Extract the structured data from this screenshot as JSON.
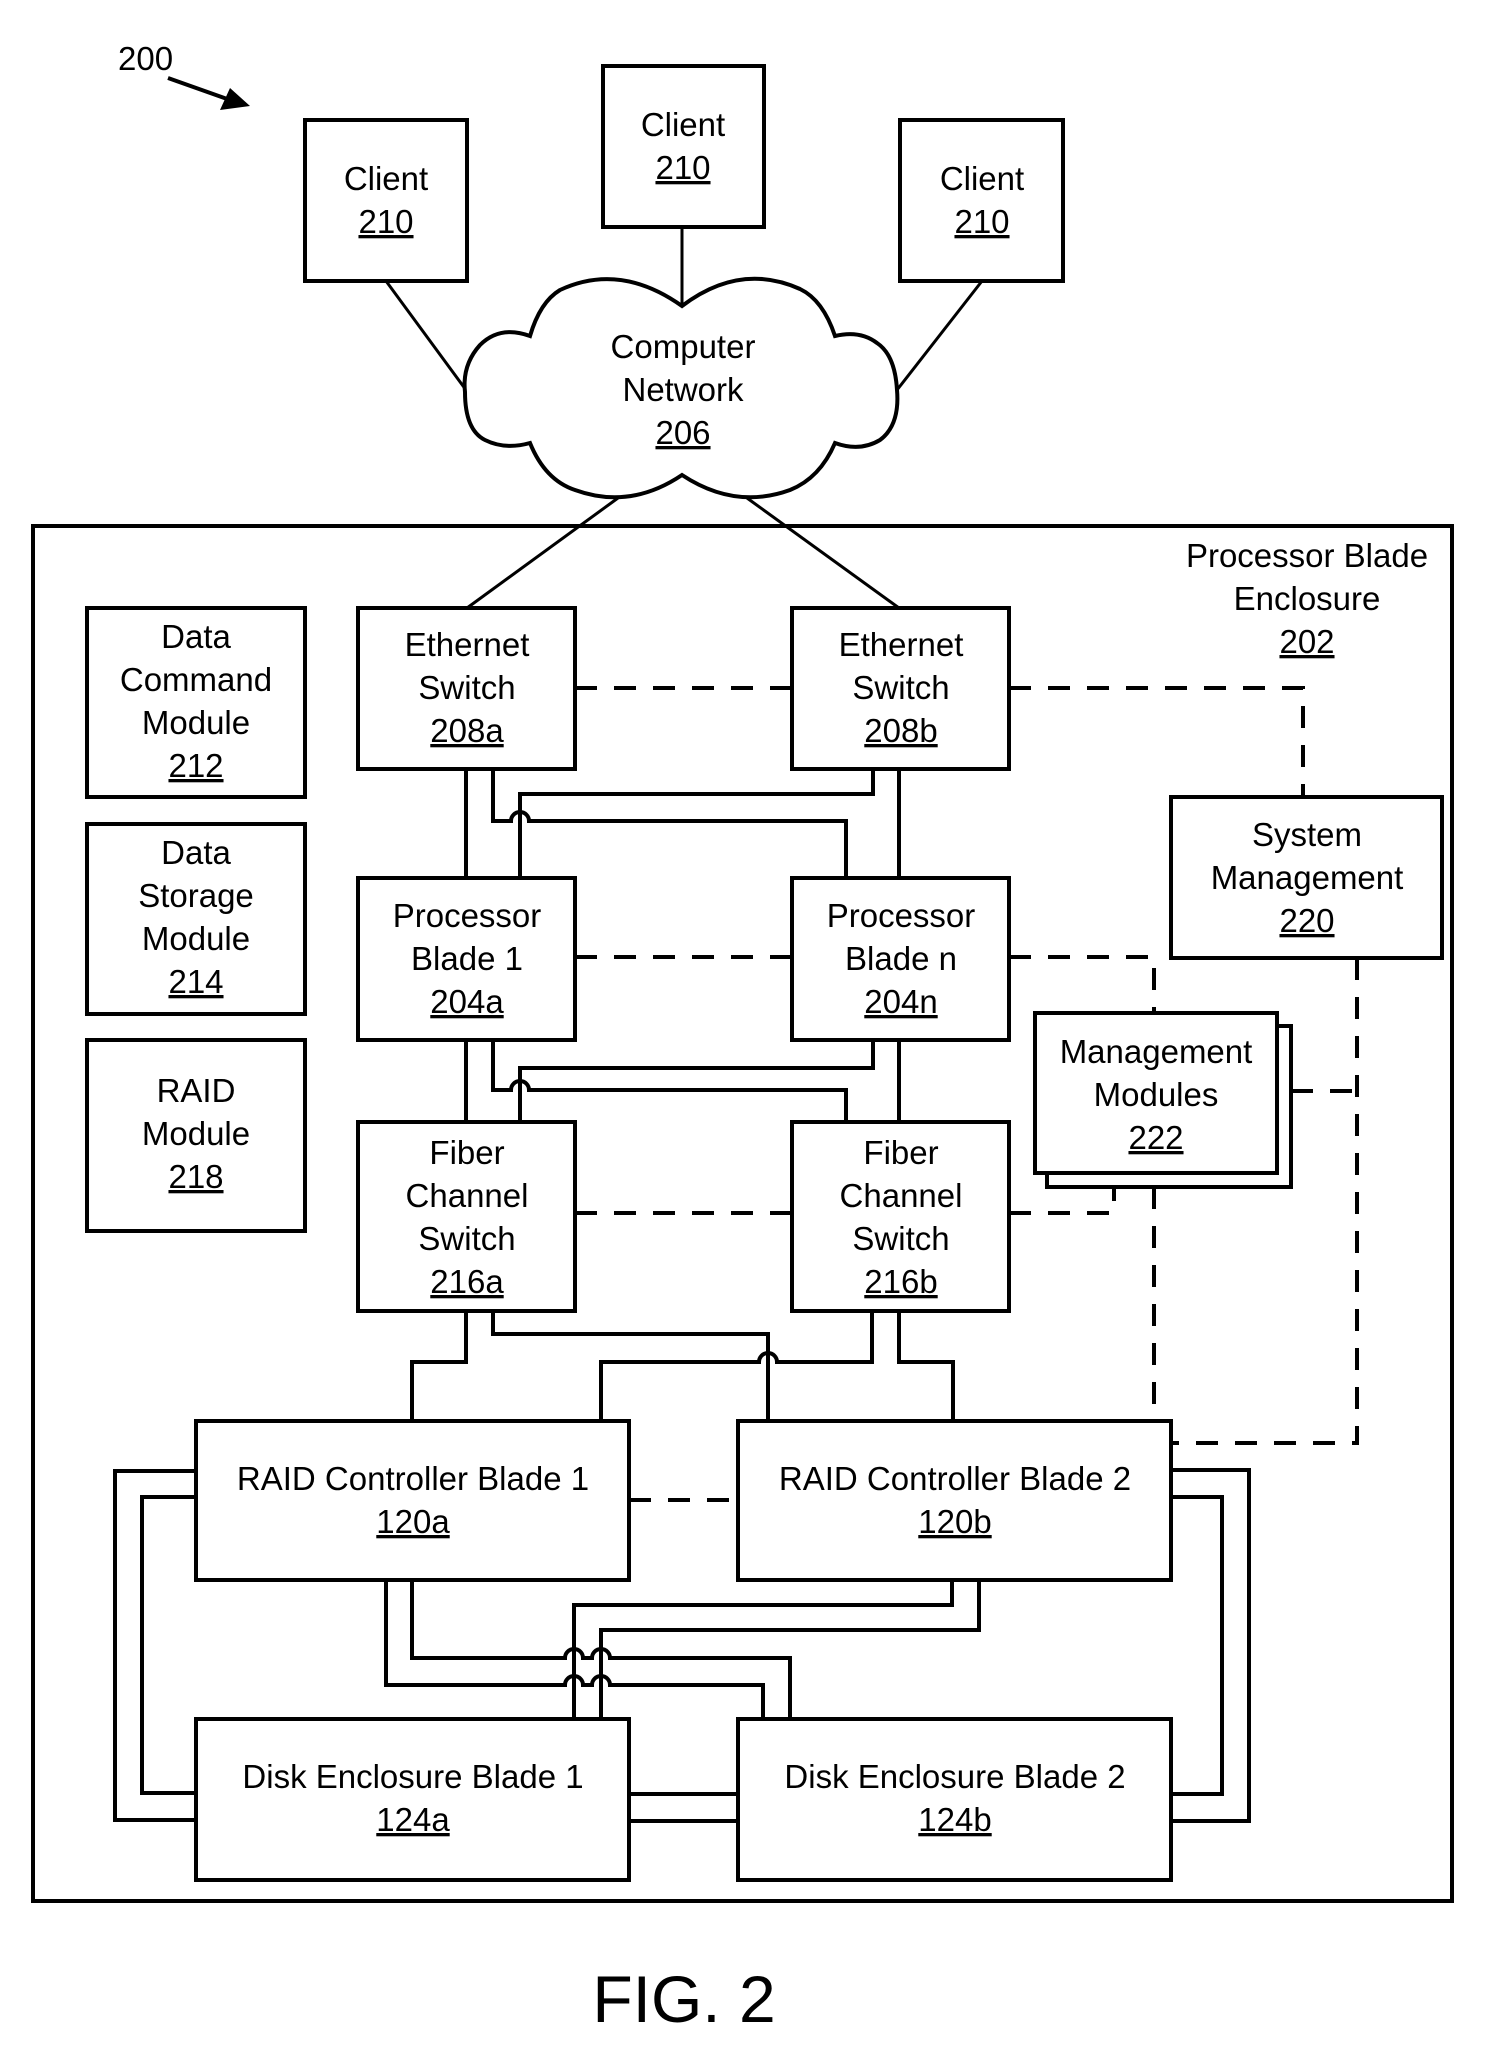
{
  "figure": {
    "ref_number": "200",
    "caption": "FIG. 2"
  },
  "clients": [
    {
      "title": "Client",
      "ref": "210"
    },
    {
      "title": "Client",
      "ref": "210"
    },
    {
      "title": "Client",
      "ref": "210"
    }
  ],
  "network": {
    "lines": [
      "Computer",
      "Network"
    ],
    "ref": "206"
  },
  "enclosure": {
    "lines": [
      "Processor Blade",
      "Enclosure"
    ],
    "ref": "202"
  },
  "modules": {
    "data_command": {
      "lines": [
        "Data",
        "Command",
        "Module"
      ],
      "ref": "212"
    },
    "data_storage": {
      "lines": [
        "Data",
        "Storage",
        "Module"
      ],
      "ref": "214"
    },
    "raid_module": {
      "lines": [
        "RAID",
        "Module"
      ],
      "ref": "218"
    }
  },
  "ethernet_switches": [
    {
      "lines": [
        "Ethernet",
        "Switch"
      ],
      "ref": "208a"
    },
    {
      "lines": [
        "Ethernet",
        "Switch"
      ],
      "ref": "208b"
    }
  ],
  "processor_blades": [
    {
      "lines": [
        "Processor",
        "Blade 1"
      ],
      "ref": "204a"
    },
    {
      "lines": [
        "Processor",
        "Blade n"
      ],
      "ref": "204n"
    }
  ],
  "fiber_switches": [
    {
      "lines": [
        "Fiber",
        "Channel",
        "Switch"
      ],
      "ref": "216a"
    },
    {
      "lines": [
        "Fiber",
        "Channel",
        "Switch"
      ],
      "ref": "216b"
    }
  ],
  "system_management": {
    "lines": [
      "System",
      "Management"
    ],
    "ref": "220"
  },
  "management_modules": {
    "lines": [
      "Management",
      "Modules"
    ],
    "ref": "222"
  },
  "raid_controllers": [
    {
      "title": "RAID Controller Blade 1",
      "ref": "120a"
    },
    {
      "title": "RAID Controller Blade 2",
      "ref": "120b"
    }
  ],
  "disk_enclosures": [
    {
      "title": "Disk Enclosure Blade 1",
      "ref": "124a"
    },
    {
      "title": "Disk Enclosure Blade 2",
      "ref": "124b"
    }
  ]
}
